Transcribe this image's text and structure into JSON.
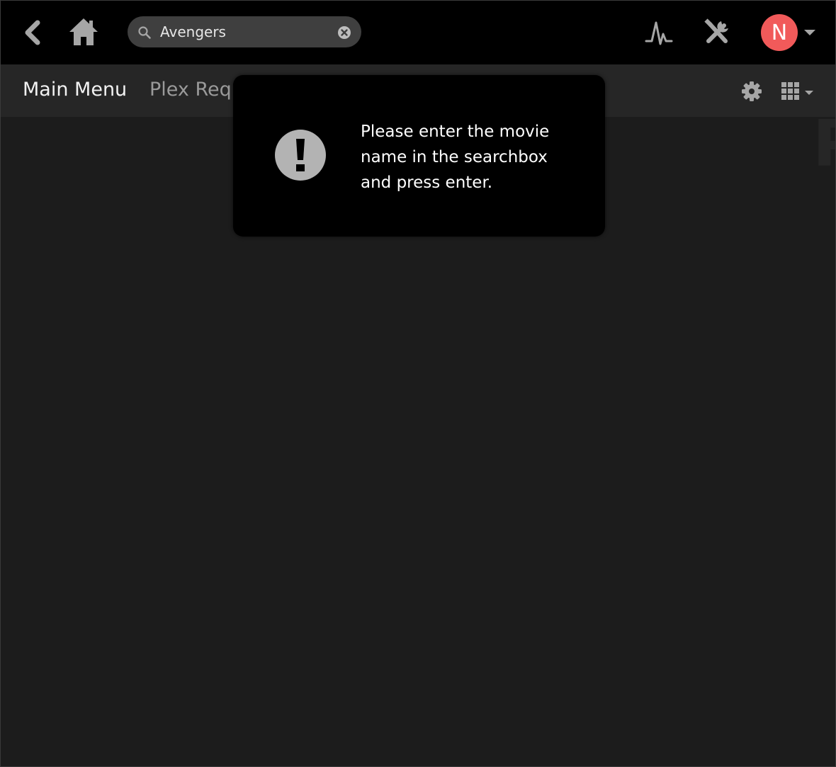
{
  "search": {
    "value": "Avengers"
  },
  "user": {
    "avatar_initial": "N",
    "avatar_color": "#f15a5a"
  },
  "nav": {
    "main_menu": "Main Menu",
    "plex_requests": "Plex Requ"
  },
  "toast": {
    "message": "Please enter the movie name in the searchbox and press enter."
  },
  "icons": {
    "back": "chevron-left-icon",
    "home": "home-icon",
    "search": "search-icon",
    "clear": "clear-circle-icon",
    "activity": "activity-pulse-icon",
    "tools": "tools-icon",
    "caret": "caret-down-icon",
    "settings": "gear-icon",
    "apps": "grid-icon",
    "alert": "exclamation-circle-icon"
  },
  "colors": {
    "topbar": "#000000",
    "subnav": "#262626",
    "background": "#1c1c1c",
    "icon": "#a6a6a6"
  }
}
